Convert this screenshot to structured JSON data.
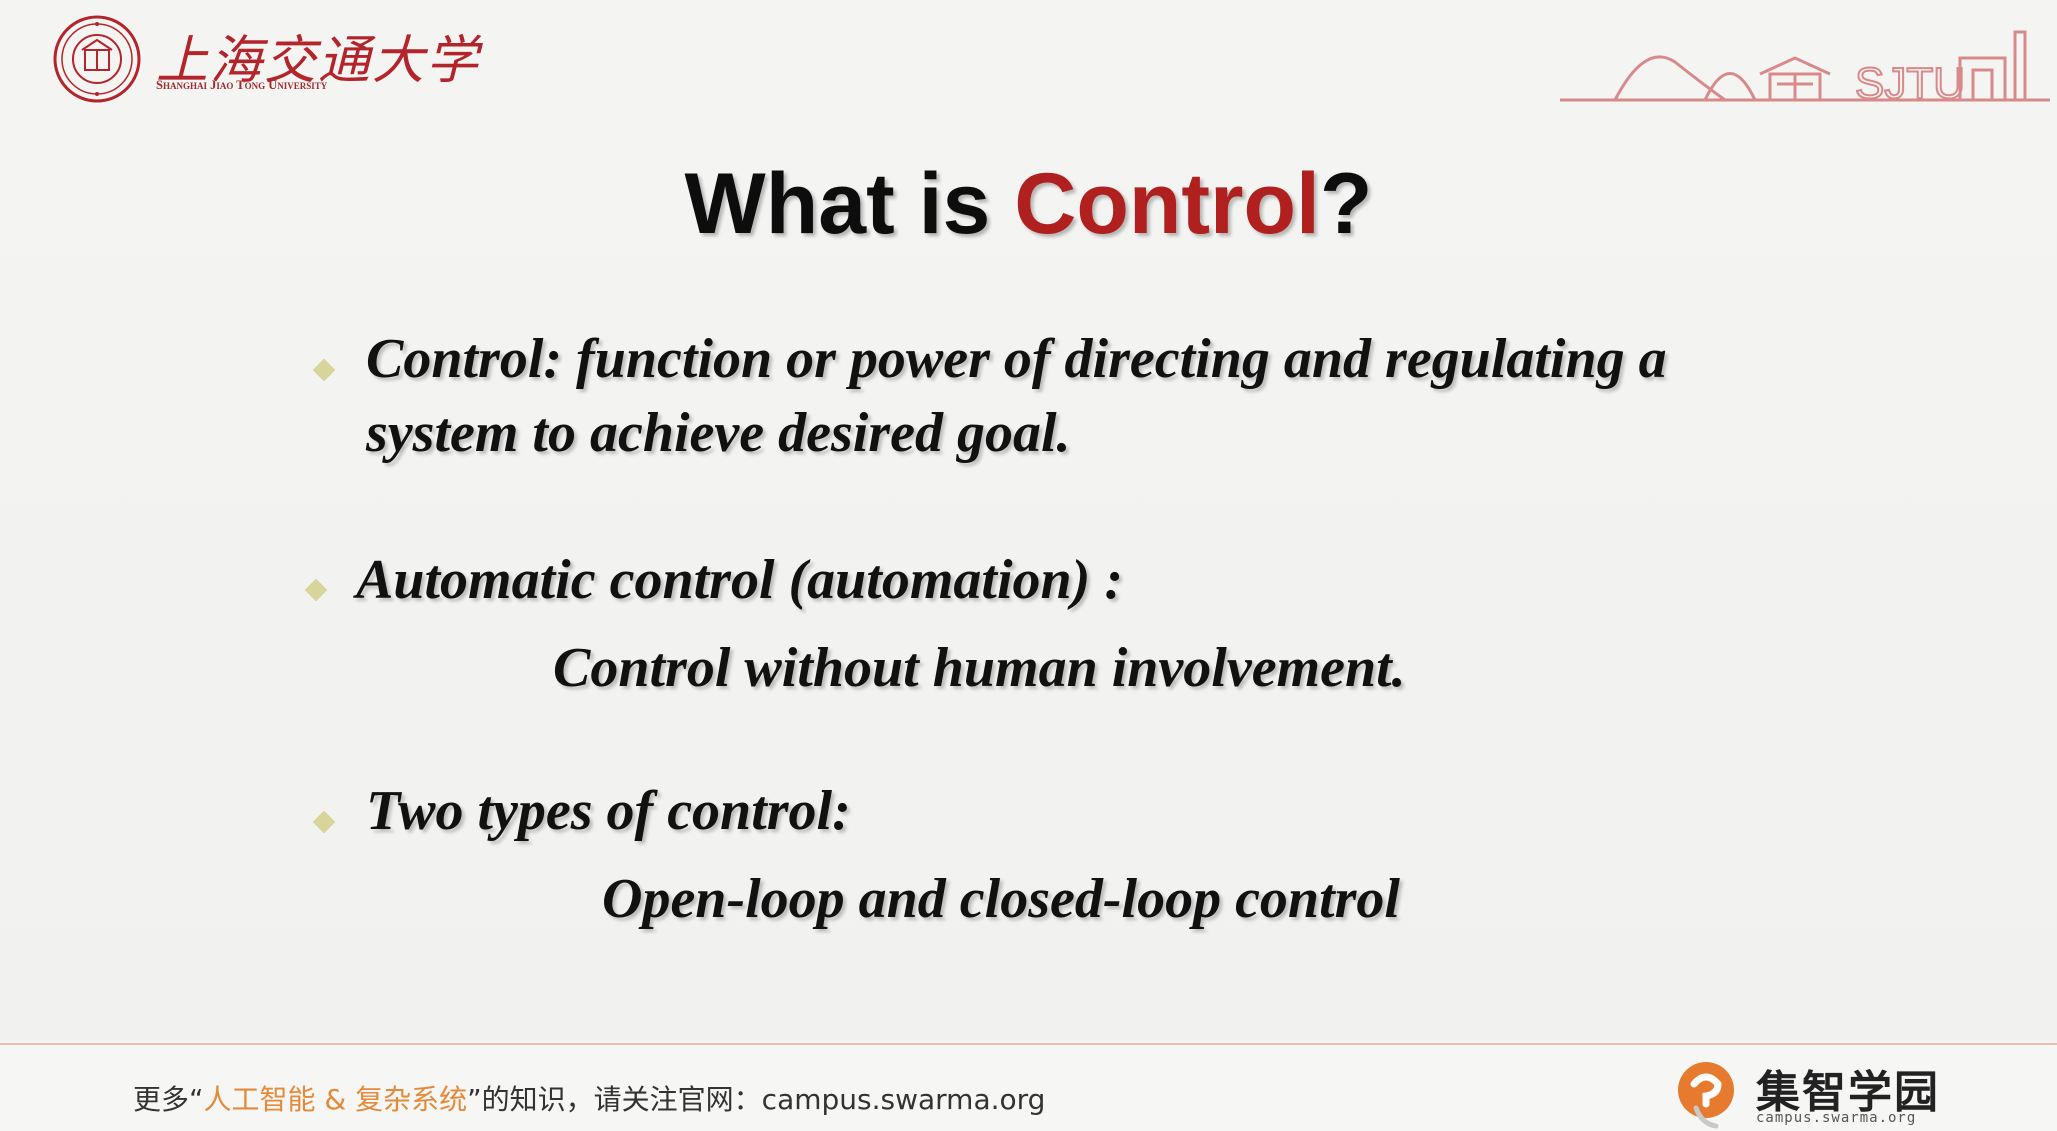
{
  "header": {
    "university_name_cn": "上海交通大学",
    "university_name_en": "Shanghai Jiao Tong University",
    "sjtu_art_text": "SJTU"
  },
  "slide": {
    "title_prefix": "What is ",
    "title_highlight": "Control",
    "title_suffix": "?",
    "title_highlight_color": "#b0201e",
    "bullets": [
      {
        "line1": "Control: function or power of directing and regulating a",
        "line2": "system to achieve desired goal."
      },
      {
        "line1": "Automatic control (automation) :",
        "line2": "Control without human involvement."
      },
      {
        "line1": "Two types of control:",
        "line2": "Open-loop and closed-loop control"
      }
    ]
  },
  "footer": {
    "prefix": "更多“",
    "highlight": "人工智能 & 复杂系统",
    "suffix": "”的知识，请关注官网：",
    "url": "campus.swarma.org",
    "brand_name": "集智学园",
    "brand_url": "campus.swarma.org",
    "accent_color": "#e58a3a"
  }
}
